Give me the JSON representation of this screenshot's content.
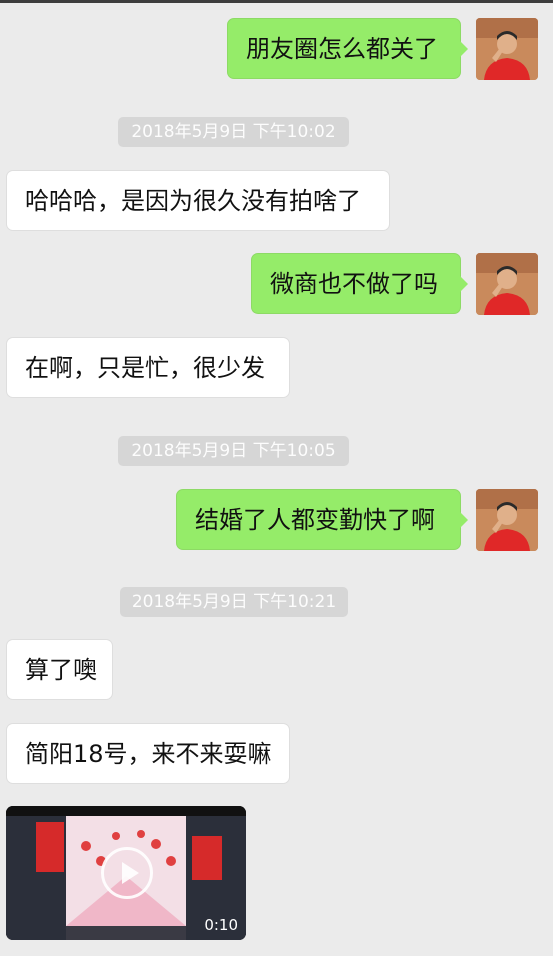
{
  "messages": [
    {
      "side": "me",
      "text": "朋友圈怎么都关了"
    },
    {
      "timestamp": "2018年5月9日 下午10:02"
    },
    {
      "side": "them",
      "text": "哈哈哈，是因为很久没有拍啥了"
    },
    {
      "side": "me",
      "text": "微商也不做了吗"
    },
    {
      "side": "them",
      "text": "在啊，只是忙，很少发"
    },
    {
      "timestamp": "2018年5月9日 下午10:05"
    },
    {
      "side": "me",
      "text": "结婚了人都变勤快了啊"
    },
    {
      "timestamp": "2018年5月9日 下午10:21"
    },
    {
      "side": "them",
      "text": "算了噢"
    },
    {
      "side": "them",
      "text": "简阳18号，来不来耍嘛"
    }
  ],
  "video": {
    "duration": "0:10"
  },
  "colors": {
    "my_bubble": "#95ec69",
    "their_bubble": "#ffffff",
    "background": "#ebebeb"
  }
}
